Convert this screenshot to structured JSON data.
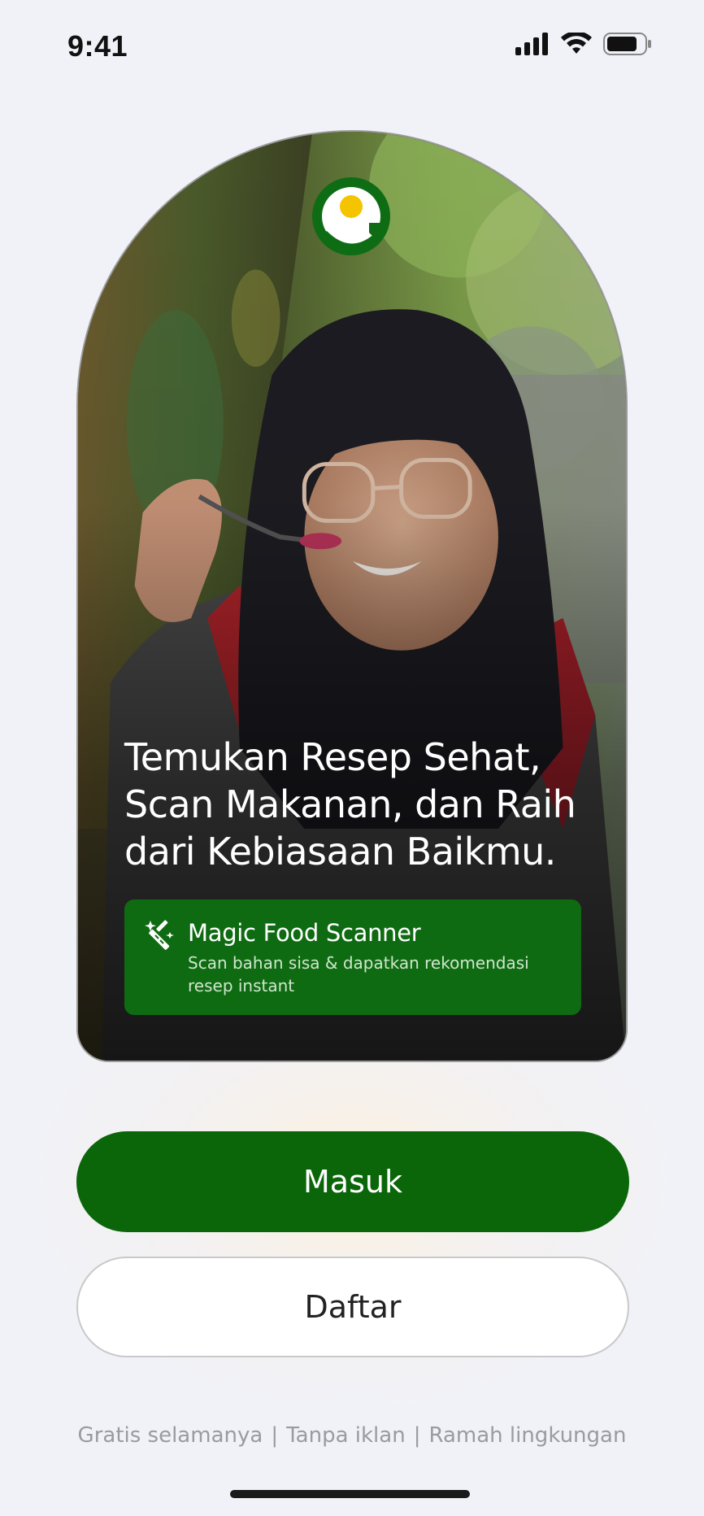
{
  "status_bar": {
    "time": "9:41",
    "icons": [
      "signal-icon",
      "wifi-icon",
      "battery-icon"
    ]
  },
  "hero": {
    "logo": "app-logo",
    "title_lines": [
      "Temukan Resep Sehat,",
      "Scan Makanan, dan Raih",
      "dari Kebiasaan Baikmu."
    ],
    "feature": {
      "icon": "magic-wand-icon",
      "title": "Magic Food Scanner",
      "description_lines": [
        "Scan bahan sisa & dapatkan rekomendasi",
        "resep instant"
      ]
    }
  },
  "actions": {
    "login_label": "Masuk",
    "register_label": "Daftar"
  },
  "footer": {
    "items": [
      "Gratis selamanya",
      "Tanpa iklan",
      "Ramah lingkungan"
    ],
    "separator": "|"
  },
  "colors": {
    "primary": "#0b6609",
    "feature_card": "#0f6b12",
    "logo_green": "#0e6d14",
    "logo_yellow": "#f5c400",
    "background": "#f1f2f8"
  }
}
